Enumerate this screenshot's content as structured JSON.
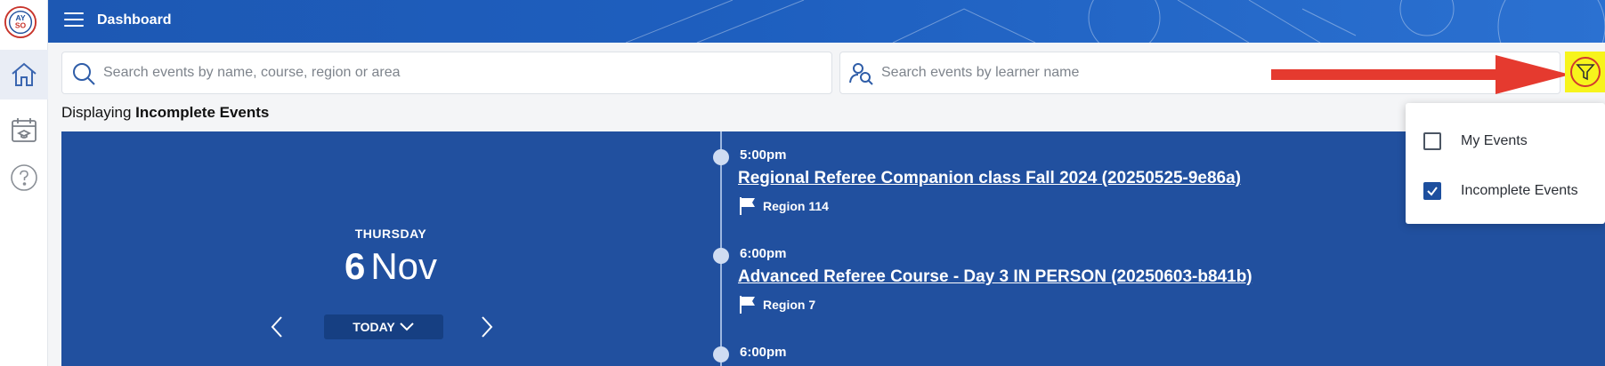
{
  "header": {
    "title": "Dashboard"
  },
  "search": {
    "events_placeholder": "Search events by name, course, region or area",
    "learner_placeholder": "Search events by learner name"
  },
  "status": {
    "prefix": "Displaying ",
    "filter": "Incomplete Events"
  },
  "day": {
    "weekday": "THURSDAY",
    "day_num": "6",
    "month": "Nov",
    "today_label": "TODAY"
  },
  "events": [
    {
      "time": "5:00pm",
      "title": "Regional Referee Companion class Fall 2024 (20250525-9e86a)",
      "region": "Region 114"
    },
    {
      "time": "6:00pm",
      "title": "Advanced Referee Course - Day 3 IN PERSON (20250603-b841b)",
      "region": "Region 7"
    },
    {
      "time": "6:00pm",
      "title": "",
      "region": ""
    }
  ],
  "filter_menu": {
    "items": [
      {
        "label": "My Events",
        "checked": false
      },
      {
        "label": "Incomplete Events",
        "checked": true
      }
    ]
  },
  "colors": {
    "header": "#1e5fbf",
    "panel": "#21509f",
    "highlight": "#f7f41c",
    "arrow": "#e53a2f",
    "checkbox": "#1d4f9e"
  },
  "icons": [
    "logo-icon",
    "home-icon",
    "calendar-course-icon",
    "help-icon",
    "hamburger-icon",
    "search-icon",
    "learner-search-icon",
    "filter-icon",
    "flag-icon",
    "chevron-left-icon",
    "chevron-right-icon",
    "chevron-down-icon"
  ]
}
